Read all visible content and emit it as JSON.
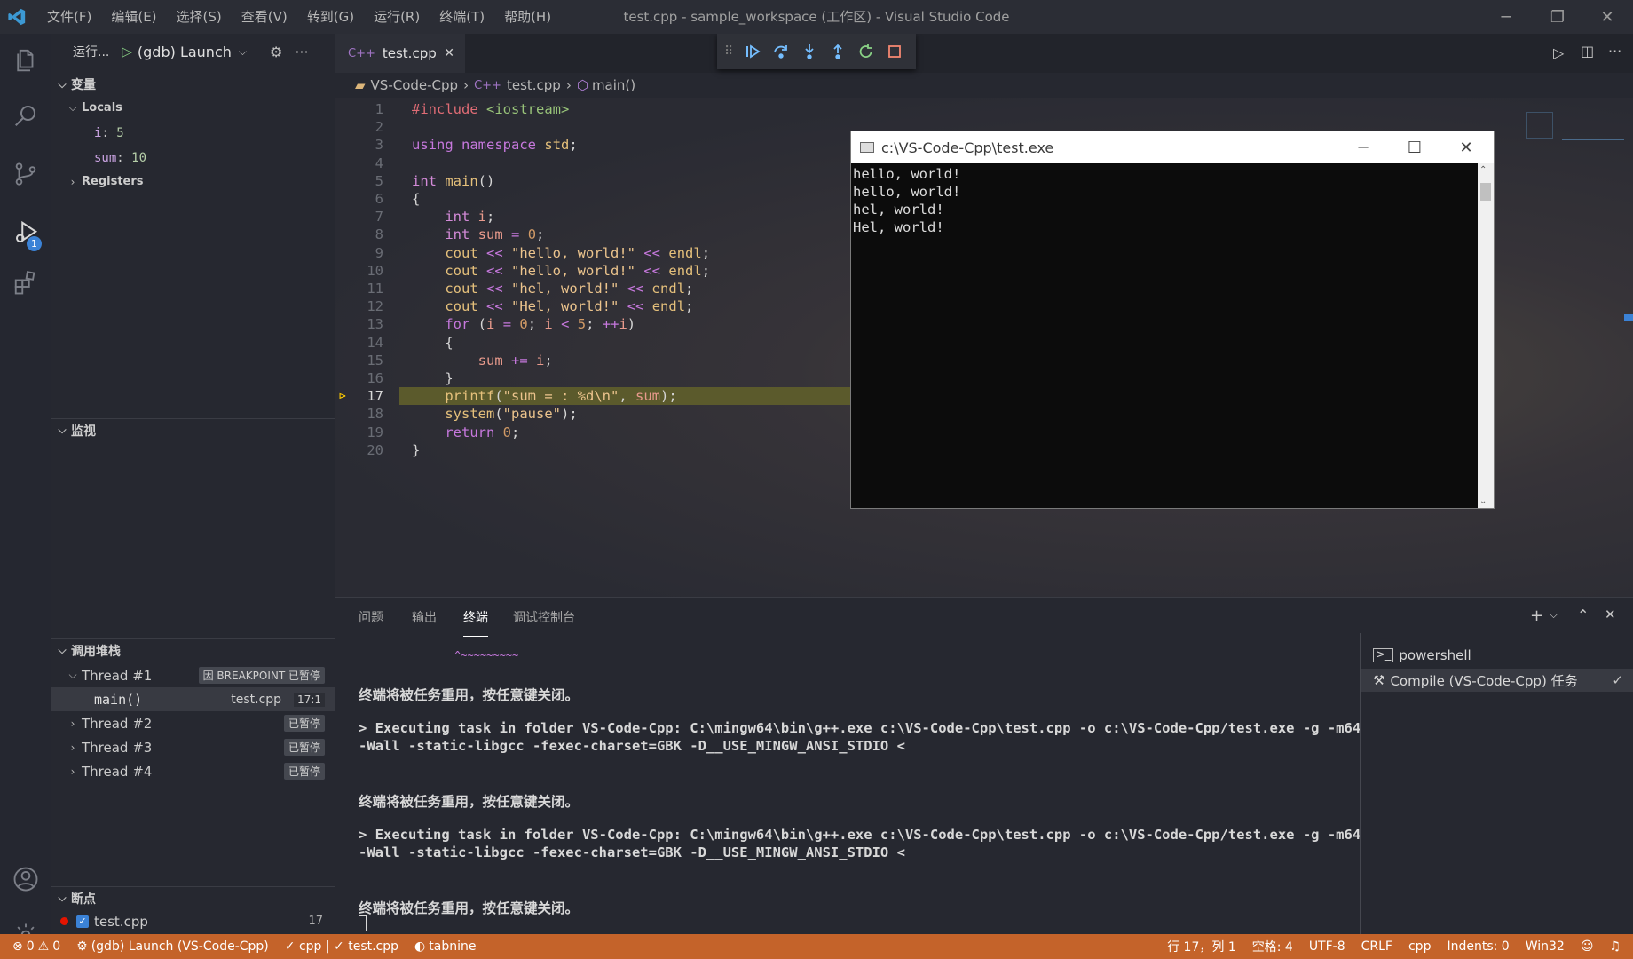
{
  "window": {
    "title": "test.cpp - sample_workspace (工作区) - Visual Studio Code",
    "menu": [
      "文件(F)",
      "编辑(E)",
      "选择(S)",
      "查看(V)",
      "转到(G)",
      "运行(R)",
      "终端(T)",
      "帮助(H)"
    ]
  },
  "activity": {
    "debug_badge": "1"
  },
  "run": {
    "label": "运行...",
    "config": "(gdb) Launch"
  },
  "variables": {
    "title": "变量",
    "locals_label": "Locals",
    "locals": [
      {
        "name": "i",
        "value": "5"
      },
      {
        "name": "sum",
        "value": "10"
      }
    ],
    "registers_label": "Registers"
  },
  "watch": {
    "title": "监视"
  },
  "callstack": {
    "title": "调用堆栈",
    "threads": [
      {
        "name": "Thread #1",
        "badge": "因 BREAKPOINT 已暂停"
      },
      {
        "name": "Thread #2",
        "badge": "已暂停"
      },
      {
        "name": "Thread #3",
        "badge": "已暂停"
      },
      {
        "name": "Thread #4",
        "badge": "已暂停"
      }
    ],
    "frame": {
      "name": "main()",
      "file": "test.cpp",
      "pos": "17:1"
    }
  },
  "breakpoints": {
    "title": "断点",
    "items": [
      {
        "file": "test.cpp",
        "line": "17"
      }
    ]
  },
  "editor": {
    "tab": "test.cpp",
    "breadcrumb": [
      "VS-Code-Cpp",
      "test.cpp",
      "main()"
    ],
    "current_line": 17,
    "lines": [
      "#include <iostream>",
      "",
      "using namespace std;",
      "",
      "int main()",
      "{",
      "    int i;",
      "    int sum = 0;",
      "    cout << \"hello, world!\" << endl;",
      "    cout << \"hello, world!\" << endl;",
      "    cout << \"hel, world!\" << endl;",
      "    cout << \"Hel, world!\" << endl;",
      "    for (i = 0; i < 5; ++i)",
      "    {",
      "        sum += i;",
      "    }",
      "    printf(\"sum = : %d\\n\", sum);",
      "    system(\"pause\");",
      "    return 0;",
      "}"
    ]
  },
  "console": {
    "title": "c:\\VS-Code-Cpp\\test.exe",
    "output": [
      "hello, world!",
      "hello, world!",
      "hel, world!",
      "Hel, world!"
    ]
  },
  "panel": {
    "tabs": [
      "问题",
      "输出",
      "终端",
      "调试控制台"
    ],
    "active_tab": "终端",
    "squiggle": "^~~~~~~~~~",
    "terminal_lines": [
      "终端将被任务重用，按任意键关闭。",
      "> Executing task in folder VS-Code-Cpp: C:\\mingw64\\bin\\g++.exe c:\\VS-Code-Cpp\\test.cpp -o c:\\VS-Code-Cpp/test.exe -g -m64",
      "-Wall -static-libgcc -fexec-charset=GBK -D__USE_MINGW_ANSI_STDIO <",
      "终端将被任务重用，按任意键关闭。",
      "> Executing task in folder VS-Code-Cpp: C:\\mingw64\\bin\\g++.exe c:\\VS-Code-Cpp\\test.cpp -o c:\\VS-Code-Cpp/test.exe -g -m64",
      "-Wall -static-libgcc -fexec-charset=GBK -D__USE_MINGW_ANSI_STDIO <",
      "终端将被任务重用，按任意键关闭。"
    ],
    "terminals": [
      {
        "name": "powershell"
      },
      {
        "name": "Compile (VS-Code-Cpp)  任务"
      }
    ]
  },
  "status": {
    "errors": "0",
    "warnings": "0",
    "debug": "(gdb) Launch (VS-Code-Cpp)",
    "lang_check": "✓ cpp | ✓ test.cpp",
    "tabnine": "tabnine",
    "position": "行 17，列 1",
    "spaces": "空格: 4",
    "encoding": "UTF-8",
    "eol": "CRLF",
    "language": "cpp",
    "indents": "Indents: 0",
    "platform": "Win32"
  },
  "colors": {
    "statusbar": "#c4632a",
    "current_line": "#5b5a2c",
    "accent": "#3b82d6"
  }
}
